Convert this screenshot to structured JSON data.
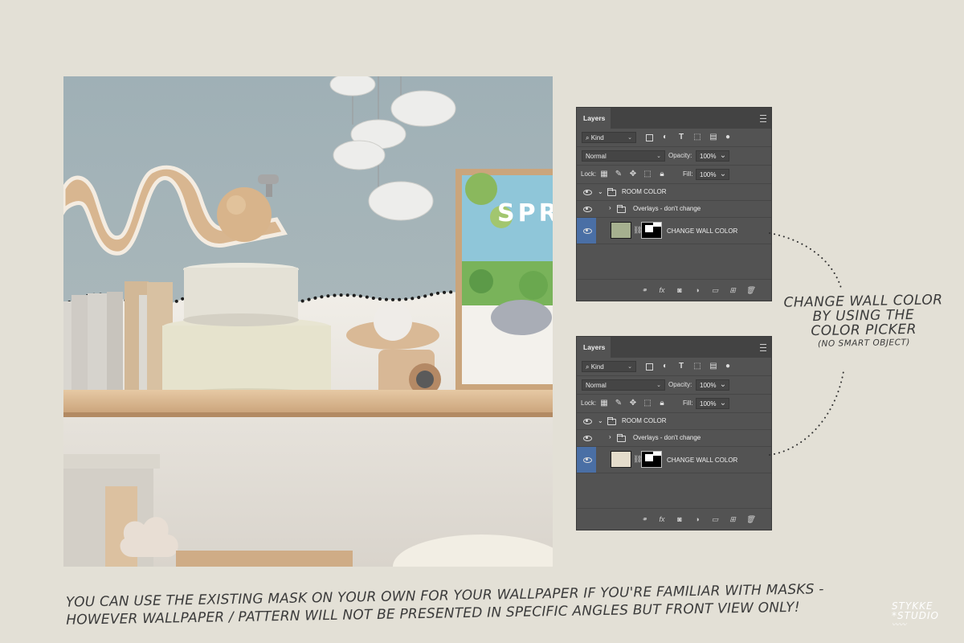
{
  "panels": [
    {
      "tab": "Layers",
      "filter": "Kind",
      "blend_mode": "Normal",
      "opacity_label": "Opacity:",
      "opacity_value": "100%",
      "lock_label": "Lock:",
      "fill_label": "Fill:",
      "fill_value": "100%",
      "group_name": "ROOM COLOR",
      "overlay_name": "Overlays - don't change",
      "layer_name": "CHANGE WALL COLOR",
      "swatch_color": "#a6b08f",
      "footer_fx": "fx"
    },
    {
      "tab": "Layers",
      "filter": "Kind",
      "blend_mode": "Normal",
      "opacity_label": "Opacity:",
      "opacity_value": "100%",
      "lock_label": "Lock:",
      "fill_label": "Fill:",
      "fill_value": "100%",
      "group_name": "ROOM COLOR",
      "overlay_name": "Overlays - don't change",
      "layer_name": "CHANGE WALL COLOR",
      "swatch_color": "#e4dccb",
      "footer_fx": "fx"
    }
  ],
  "annotation": {
    "line1": "CHANGE WALL COLOR",
    "line2": "BY USING THE",
    "line3": "COLOR PICKER",
    "line4": "(NO SMART OBJECT)"
  },
  "caption": {
    "line1": "YOU CAN USE THE EXISTING MASK ON YOUR OWN FOR YOUR WALLPAPER IF YOU'RE FAMILIAR WITH MASKS -",
    "line2": "HOWEVER WALLPAPER / PATTERN WILL NOT BE PRESENTED IN SPECIFIC ANGLES BUT FRONT VIEW ONLY!"
  },
  "logo": {
    "line1": "STYKKE",
    "line2": "*STUDIO"
  },
  "artwork": {
    "poster_text": "SPRI"
  },
  "colors": {
    "background": "#e3e0d6",
    "panel": "#535353",
    "selected_layer_accent": "#4a6fa5",
    "wall_top": "#a8b6b9",
    "wall_bottom": "#e9e5df"
  }
}
